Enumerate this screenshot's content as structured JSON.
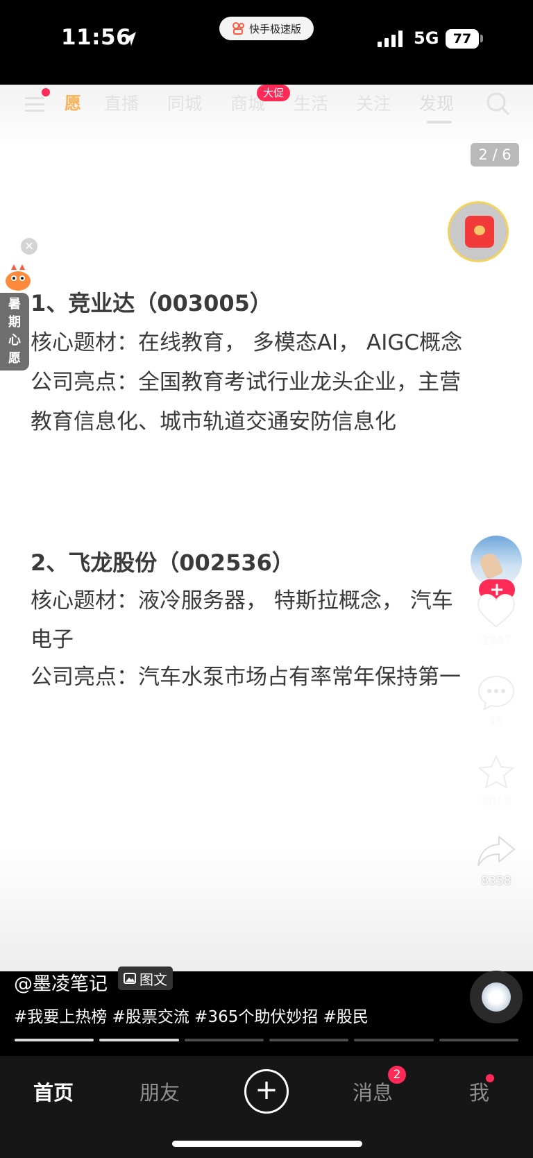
{
  "status_bar": {
    "time": "11:56",
    "app_name": "快手极速版",
    "network": "5G",
    "battery": "77"
  },
  "top_nav": {
    "wish_icon": "愿",
    "tabs": [
      "直播",
      "同城",
      "商城",
      "生活",
      "关注",
      "发现"
    ],
    "active_tab": "发现",
    "promo_badge": "大促"
  },
  "page_counter": "2 / 6",
  "floating_widget": {
    "label": "暑期心愿"
  },
  "article": {
    "stock1": {
      "title": "1、竞业达（003005）",
      "line1": "核心题材：在线教育， 多模态AI， AIGC概念",
      "line2": "公司亮点：全国教育考试行业龙头企业，主营",
      "line3": "教育信息化、城市轨道交通安防信息化"
    },
    "stock2": {
      "title": "2、飞龙股份（002536）",
      "line1": "核心题材：液冷服务器， 特斯拉概念， 汽车",
      "line2": "电子",
      "line3": "公司亮点：汽车水泵市场占有率常年保持第一"
    }
  },
  "actions": {
    "follow": "+",
    "likes": "2947",
    "comments": "95",
    "favorites": "3013",
    "shares": "8358"
  },
  "post": {
    "author": "@墨凌笔记",
    "type_tag": "图文",
    "hashtags": "#我要上热榜 #股票交流 #365个助伏妙招 #股民",
    "progress": {
      "total_pages": 6,
      "current_page": 2
    }
  },
  "tab_bar": {
    "home": "首页",
    "friends": "朋友",
    "create": "+",
    "messages": "消息",
    "messages_badge": "2",
    "me": "我"
  },
  "colors": {
    "accent_red": "#ff2a55",
    "text_dark": "#3a3a3a",
    "tab_bar_bg": "#161616"
  },
  "icons": [
    "menu-icon",
    "search-icon",
    "red-packet-icon",
    "heart-icon",
    "comment-icon",
    "star-icon",
    "share-icon",
    "image-icon",
    "music-disc-icon",
    "location-arrow-icon",
    "signal-icon"
  ]
}
